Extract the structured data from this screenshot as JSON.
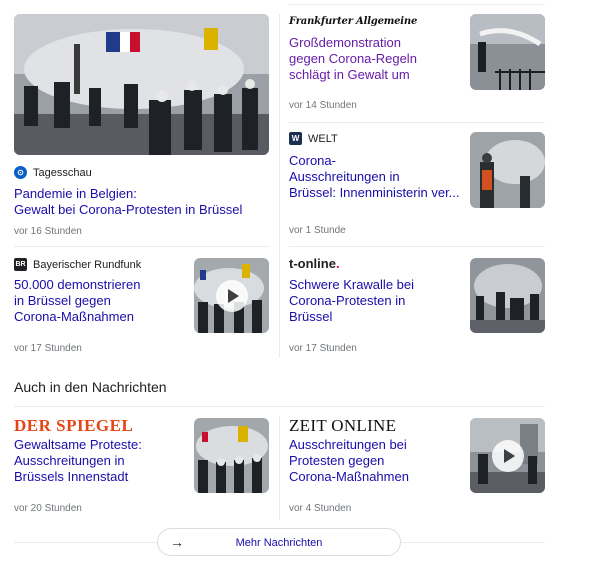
{
  "top_stories": [
    {
      "source": "Tagesschau",
      "source_icon": "tagesschau-icon",
      "title_lines": [
        "Pandemie in Belgien:",
        "Gewalt bei Corona-Protesten in Brüssel"
      ],
      "time": "vor 16 Stunden"
    },
    {
      "source": "Frankfurter Allgemeine",
      "source_icon": "faz-logo",
      "title_lines": [
        "Großdemonstration",
        "gegen Corona-Regeln",
        "schlägt in Gewalt um"
      ],
      "time": "vor 14 Stunden",
      "visited": true
    },
    {
      "source": "WELT",
      "source_icon": "welt-icon",
      "favicon_letter": "W",
      "title_lines": [
        "Corona-",
        "Ausschreitungen in",
        "Brüssel: Innenministerin ver..."
      ],
      "time": "vor 1 Stunde"
    },
    {
      "source": "Bayerischer Rundfunk",
      "source_icon": "br-icon",
      "favicon_letter": "BR",
      "title_lines": [
        "50.000 demonstrieren",
        "in Brüssel gegen",
        "Corona-Maßnahmen"
      ],
      "time": "vor 17 Stunden",
      "video": true
    },
    {
      "source": "t-online",
      "source_icon": "t-online-logo",
      "title_lines": [
        "Schwere Krawalle bei",
        "Corona-Protesten in",
        "Brüssel"
      ],
      "time": "vor 17 Stunden"
    }
  ],
  "also_in_news": {
    "heading": "Auch in den Nachrichten",
    "items": [
      {
        "source": "DER SPIEGEL",
        "source_icon": "spiegel-logo",
        "title_lines": [
          "Gewaltsame Proteste:",
          "Ausschreitungen in",
          "Brüssels Innenstadt"
        ],
        "time": "vor 20 Stunden"
      },
      {
        "source": "ZEIT ONLINE",
        "source_icon": "zeit-online-logo",
        "title_lines": [
          "Ausschreitungen bei",
          "Protesten gegen",
          "Corona-Maßnahmen"
        ],
        "time": "vor 4 Stunden",
        "video": true
      }
    ]
  },
  "more_button": {
    "label": "Mehr Nachrichten",
    "icon": "arrow-right-icon"
  },
  "colors": {
    "link": "#1a0dab",
    "visited_link": "#681da8",
    "meta": "#70757a",
    "divider": "#ebebeb",
    "spiegel_red": "#e64415",
    "tagesschau_blue": "#0a5fc8",
    "welt_navy": "#1b2f4e",
    "tonline_magenta": "#e20074"
  }
}
